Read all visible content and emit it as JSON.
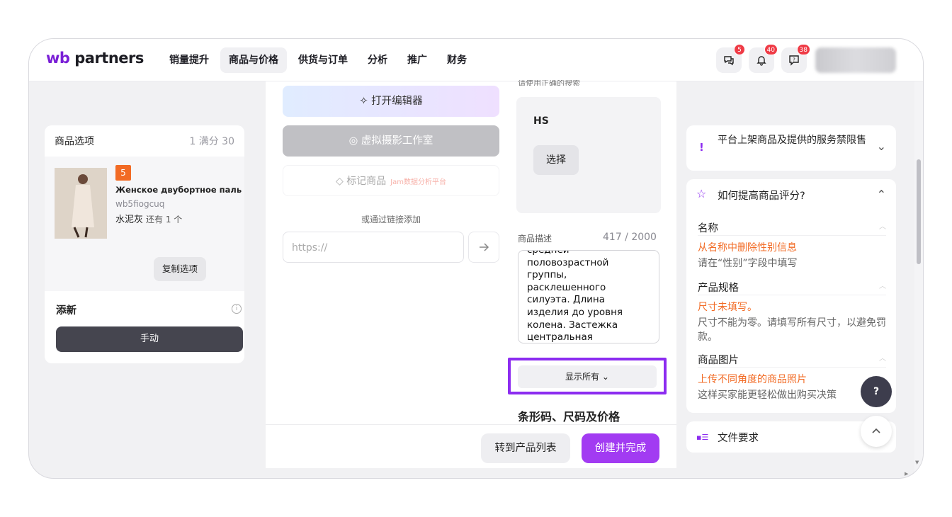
{
  "app": {
    "logo_prefix": "wb",
    "logo_suffix": " partners"
  },
  "nav": [
    "销量提升",
    "商品与价格",
    "供货与订单",
    "分析",
    "推广",
    "财务"
  ],
  "header_icons": [
    {
      "icon": "chat-icon",
      "badge": "5"
    },
    {
      "icon": "bell-icon",
      "badge": "40"
    },
    {
      "icon": "message-question-icon",
      "badge": "38"
    }
  ],
  "product_options": {
    "title": "商品选项",
    "count": "1 满分 30",
    "badge": "5",
    "name": "Женское двубортное пальто...",
    "code": "wb5fiogcuq",
    "color": "水泥灰",
    "more": "还有 1 个",
    "copy_label": "复制选项",
    "add_new": "添新",
    "info": "i",
    "manual_label": "手动"
  },
  "media": {
    "editor_label": "打开编辑器",
    "studio_label": "虚拟摄影工作室",
    "tag_label": "标记商品",
    "tag_watermark": "Jam数据分析平台",
    "or_link": "或通过链接添加",
    "url_placeholder": "https://"
  },
  "hs": {
    "top_text": "请使用正确的搜索",
    "label": "HS",
    "select_label": "选择"
  },
  "description": {
    "label": "商品描述",
    "count": "417 / 2000",
    "text": "средней\nполовозрастной\nгруппы,\nрасклешенного\nсилуэта. Длина\nизделия до уровня\nколена. Застежка\nцентральная"
  },
  "show_all": "显示所有",
  "section_title": "条形码、尺码及价格",
  "footer": {
    "to_list": "转到产品列表",
    "create": "创建并完成"
  },
  "right": {
    "warning_mark": "!",
    "warning_text": "平台上架商品及提供的服务禁限售",
    "tips_title": "如何提高商品评分?",
    "tips": [
      {
        "head": "名称",
        "warn": "从名称中删除性别信息",
        "desc": "请在“性别”字段中填写"
      },
      {
        "head": "产品规格",
        "warn": "尺寸未填写。",
        "desc": "尺寸不能为零。请填写所有尺寸，以避免罚款。"
      },
      {
        "head": "商品图片",
        "warn": "上传不同角度的商品照片",
        "desc": "这样买家能更轻松做出购买决策"
      }
    ],
    "file_req": "文件要求"
  },
  "help_label": "?",
  "colors": {
    "accent": "#a23bf2",
    "highlight": "#8c2cf0",
    "warning": "#f26b25",
    "badge": "#ef3b46"
  }
}
